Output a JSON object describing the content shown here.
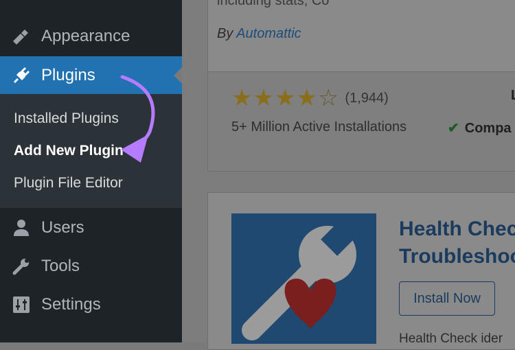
{
  "sidebar": {
    "appearance": {
      "label": "Appearance",
      "icon": "paintbrush-icon"
    },
    "plugins": {
      "label": "Plugins",
      "icon": "plug-icon"
    },
    "submenu": [
      {
        "label": "Installed Plugins"
      },
      {
        "label": "Add New Plugin"
      },
      {
        "label": "Plugin File Editor"
      }
    ],
    "users": {
      "label": "Users",
      "icon": "user-icon"
    },
    "tools": {
      "label": "Tools",
      "icon": "wrench-icon"
    },
    "settings": {
      "label": "Settings",
      "icon": "sliders-icon"
    }
  },
  "main": {
    "top_plugin": {
      "description_cut": "including stats, Co",
      "by_label": "By",
      "author": "Automattic",
      "rating_stars": 4,
      "rating_count": "(1,944)",
      "installs": "5+ Million Active Installations",
      "compat_label": "Compa",
      "last_updated_cut": "L"
    },
    "health_plugin": {
      "title_line1": "Health Check",
      "title_line2": "Troubleshoo",
      "install_label": "Install Now",
      "description_cut": "Health Check ider"
    }
  },
  "colors": {
    "sidebar_bg": "#1d2327",
    "active_bg": "#2271b1",
    "arrow": "#b57cff"
  }
}
